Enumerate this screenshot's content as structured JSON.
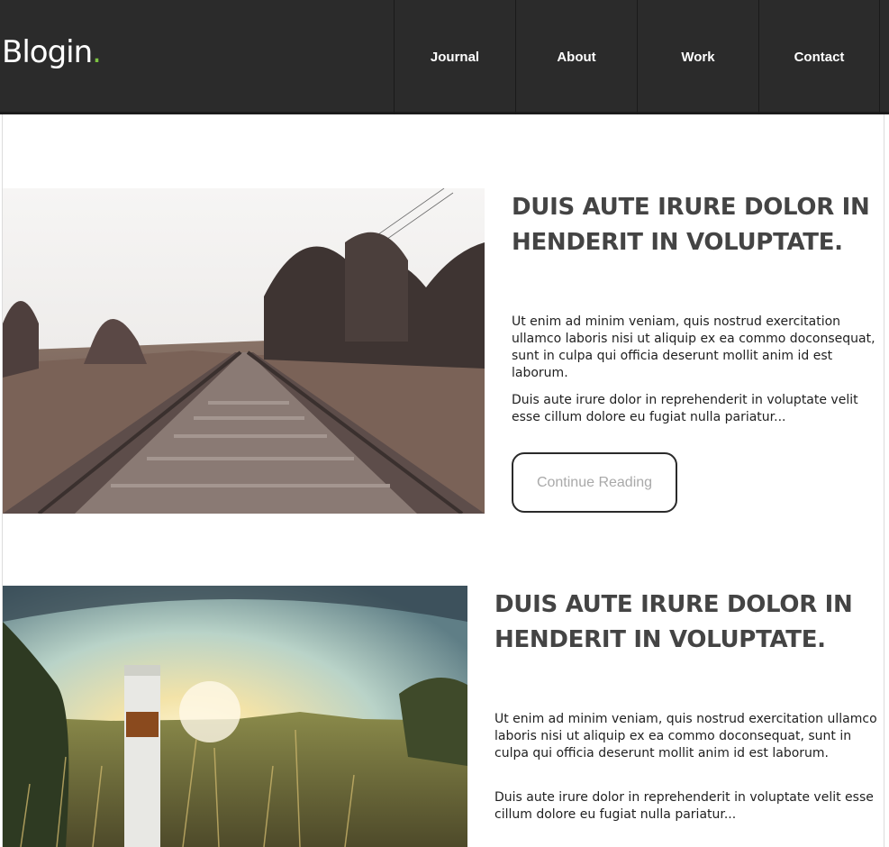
{
  "header": {
    "logo_text": "Blogin",
    "logo_dot": ".",
    "nav": [
      "Journal",
      "About",
      "Work",
      "Contact"
    ]
  },
  "posts": [
    {
      "image": "railway-tracks-photo",
      "title": "DUIS AUTE IRURE DOLOR IN HENDERIT IN VOLUPTATE.",
      "paragraph1": "Ut enim ad minim veniam, quis nostrud exercitation ullamco laboris nisi ut aliquip ex ea commo doconsequat, sunt in culpa qui officia deserunt mollit anim id est laborum.",
      "paragraph2": "Duis aute irure dolor in reprehenderit in voluptate velit esse cillum dolore eu fugiat nulla pariatur...",
      "button_label": "Continue Reading"
    },
    {
      "image": "sunset-field-marker-photo",
      "title": "DUIS AUTE IRURE DOLOR IN HENDERIT IN VOLUPTATE.",
      "paragraph1": "Ut enim ad minim veniam, quis nostrud exercitation ullamco laboris nisi ut aliquip ex ea commo doconsequat, sunt in culpa qui officia deserunt mollit anim id est laborum.",
      "paragraph2": "Duis aute irure dolor in reprehenderit in voluptate velit esse cillum dolore eu fugiat nulla pariatur..."
    }
  ],
  "colors": {
    "header_bg": "#2b2b2b",
    "logo_accent": "#7cc242",
    "title": "#444444",
    "button_text": "#a9a9a9"
  }
}
